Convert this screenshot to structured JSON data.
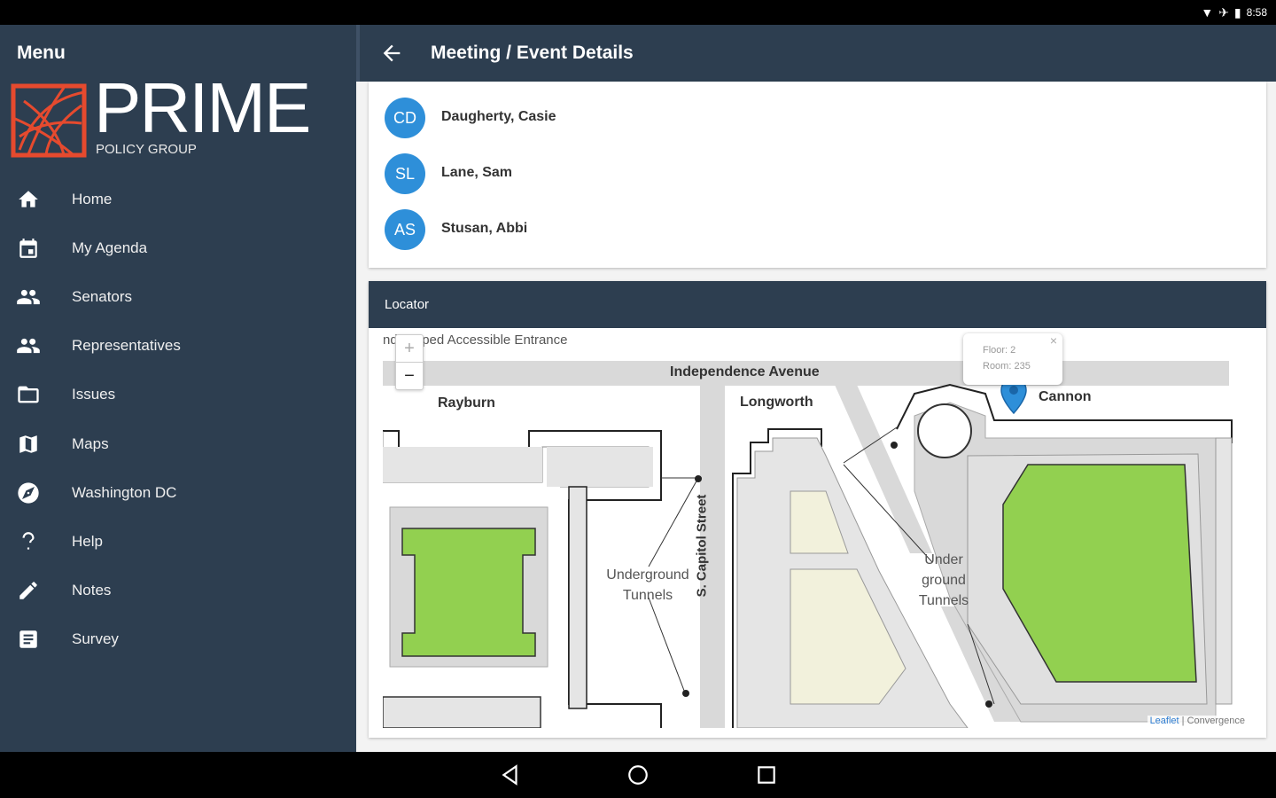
{
  "status_bar": {
    "time": "8:58"
  },
  "drawer": {
    "title": "Menu",
    "logo": {
      "word": "PRIME",
      "sub": "POLICY GROUP"
    },
    "items": [
      {
        "label": "Home",
        "icon": "home-icon"
      },
      {
        "label": "My Agenda",
        "icon": "calendar-icon"
      },
      {
        "label": "Senators",
        "icon": "people-icon"
      },
      {
        "label": "Representatives",
        "icon": "people-icon"
      },
      {
        "label": "Issues",
        "icon": "folder-icon"
      },
      {
        "label": "Maps",
        "icon": "map-icon"
      },
      {
        "label": "Washington DC",
        "icon": "compass-icon"
      },
      {
        "label": "Help",
        "icon": "help-icon"
      },
      {
        "label": "Notes",
        "icon": "pencil-icon"
      },
      {
        "label": "Survey",
        "icon": "document-icon"
      }
    ]
  },
  "app_bar": {
    "title": "Meeting / Event Details",
    "back_icon": "arrow-back-icon"
  },
  "attendees": [
    {
      "initials": "CD",
      "name": "Daugherty, Casie"
    },
    {
      "initials": "SL",
      "name": "Lane, Sam"
    },
    {
      "initials": "AS",
      "name": "Stusan, Abbi"
    }
  ],
  "locator": {
    "title": "Locator",
    "map": {
      "top_label": "ndicapped Accessible Entrance",
      "street": "Independence Avenue",
      "buildings": [
        "Rayburn",
        "Longworth",
        "Cannon"
      ],
      "side_street": "S. Capitol Street",
      "tunnels_1": [
        "Underground",
        "Tunnels"
      ],
      "tunnels_2": [
        "Under",
        "ground",
        "Tunnels"
      ],
      "zoom_in": "+",
      "zoom_out": "−",
      "popup": {
        "floor": "Floor: 2",
        "room": "Room: 235",
        "close": "×"
      },
      "attribution_link": "Leaflet",
      "attribution_rest": " | Convergence",
      "colors": {
        "green": "#92d050",
        "cream": "#f2f1dc",
        "grey": "#d9d9d9",
        "marker": "#2e8fd9"
      }
    }
  },
  "colors": {
    "primary": "#2d3e50",
    "avatar": "#2e8fd9",
    "logo_red": "#e64a2e"
  }
}
